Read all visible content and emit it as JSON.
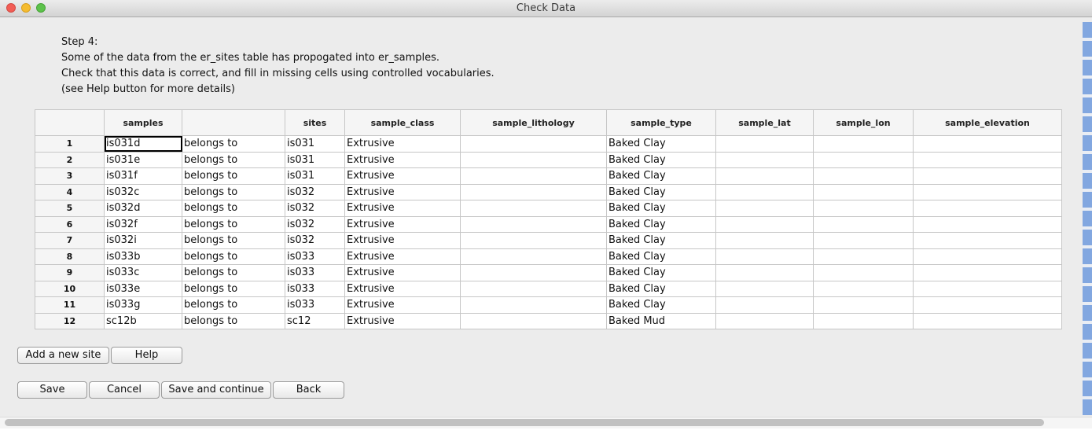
{
  "window": {
    "title": "Check Data"
  },
  "instructions": {
    "lines": [
      "Step 4:",
      "Some of the data from the er_sites table has propogated into er_samples.",
      "Check that this data is correct, and fill in missing cells using controlled vocabularies.",
      "(see Help button for more details)"
    ]
  },
  "grid": {
    "columns": [
      "",
      "samples",
      "",
      "sites",
      "sample_class",
      "sample_lithology",
      "sample_type",
      "sample_lat",
      "sample_lon",
      "sample_elevation"
    ],
    "rows": [
      [
        "1",
        "is031d",
        "belongs to",
        "is031",
        "Extrusive",
        "",
        "Baked Clay",
        "",
        "",
        ""
      ],
      [
        "2",
        "is031e",
        "belongs to",
        "is031",
        "Extrusive",
        "",
        "Baked Clay",
        "",
        "",
        ""
      ],
      [
        "3",
        "is031f",
        "belongs to",
        "is031",
        "Extrusive",
        "",
        "Baked Clay",
        "",
        "",
        ""
      ],
      [
        "4",
        "is032c",
        "belongs to",
        "is032",
        "Extrusive",
        "",
        "Baked Clay",
        "",
        "",
        ""
      ],
      [
        "5",
        "is032d",
        "belongs to",
        "is032",
        "Extrusive",
        "",
        "Baked Clay",
        "",
        "",
        ""
      ],
      [
        "6",
        "is032f",
        "belongs to",
        "is032",
        "Extrusive",
        "",
        "Baked Clay",
        "",
        "",
        ""
      ],
      [
        "7",
        "is032i",
        "belongs to",
        "is032",
        "Extrusive",
        "",
        "Baked Clay",
        "",
        "",
        ""
      ],
      [
        "8",
        "is033b",
        "belongs to",
        "is033",
        "Extrusive",
        "",
        "Baked Clay",
        "",
        "",
        ""
      ],
      [
        "9",
        "is033c",
        "belongs to",
        "is033",
        "Extrusive",
        "",
        "Baked Clay",
        "",
        "",
        ""
      ],
      [
        "10",
        "is033e",
        "belongs to",
        "is033",
        "Extrusive",
        "",
        "Baked Clay",
        "",
        "",
        ""
      ],
      [
        "11",
        "is033g",
        "belongs to",
        "is033",
        "Extrusive",
        "",
        "Baked Clay",
        "",
        "",
        ""
      ],
      [
        "12",
        "sc12b",
        "belongs to",
        "sc12",
        "Extrusive",
        "",
        "Baked Mud",
        "",
        "",
        ""
      ]
    ],
    "selected_cell": "is031d"
  },
  "buttons": {
    "add_site": "Add a new site",
    "help": "Help",
    "save": "Save",
    "cancel": "Cancel",
    "save_continue": "Save and continue",
    "back": "Back"
  },
  "colors": {
    "close": "#f25d55",
    "minimize": "#f5bc30",
    "maximize": "#5dc24b",
    "window_bg": "#ececec"
  }
}
